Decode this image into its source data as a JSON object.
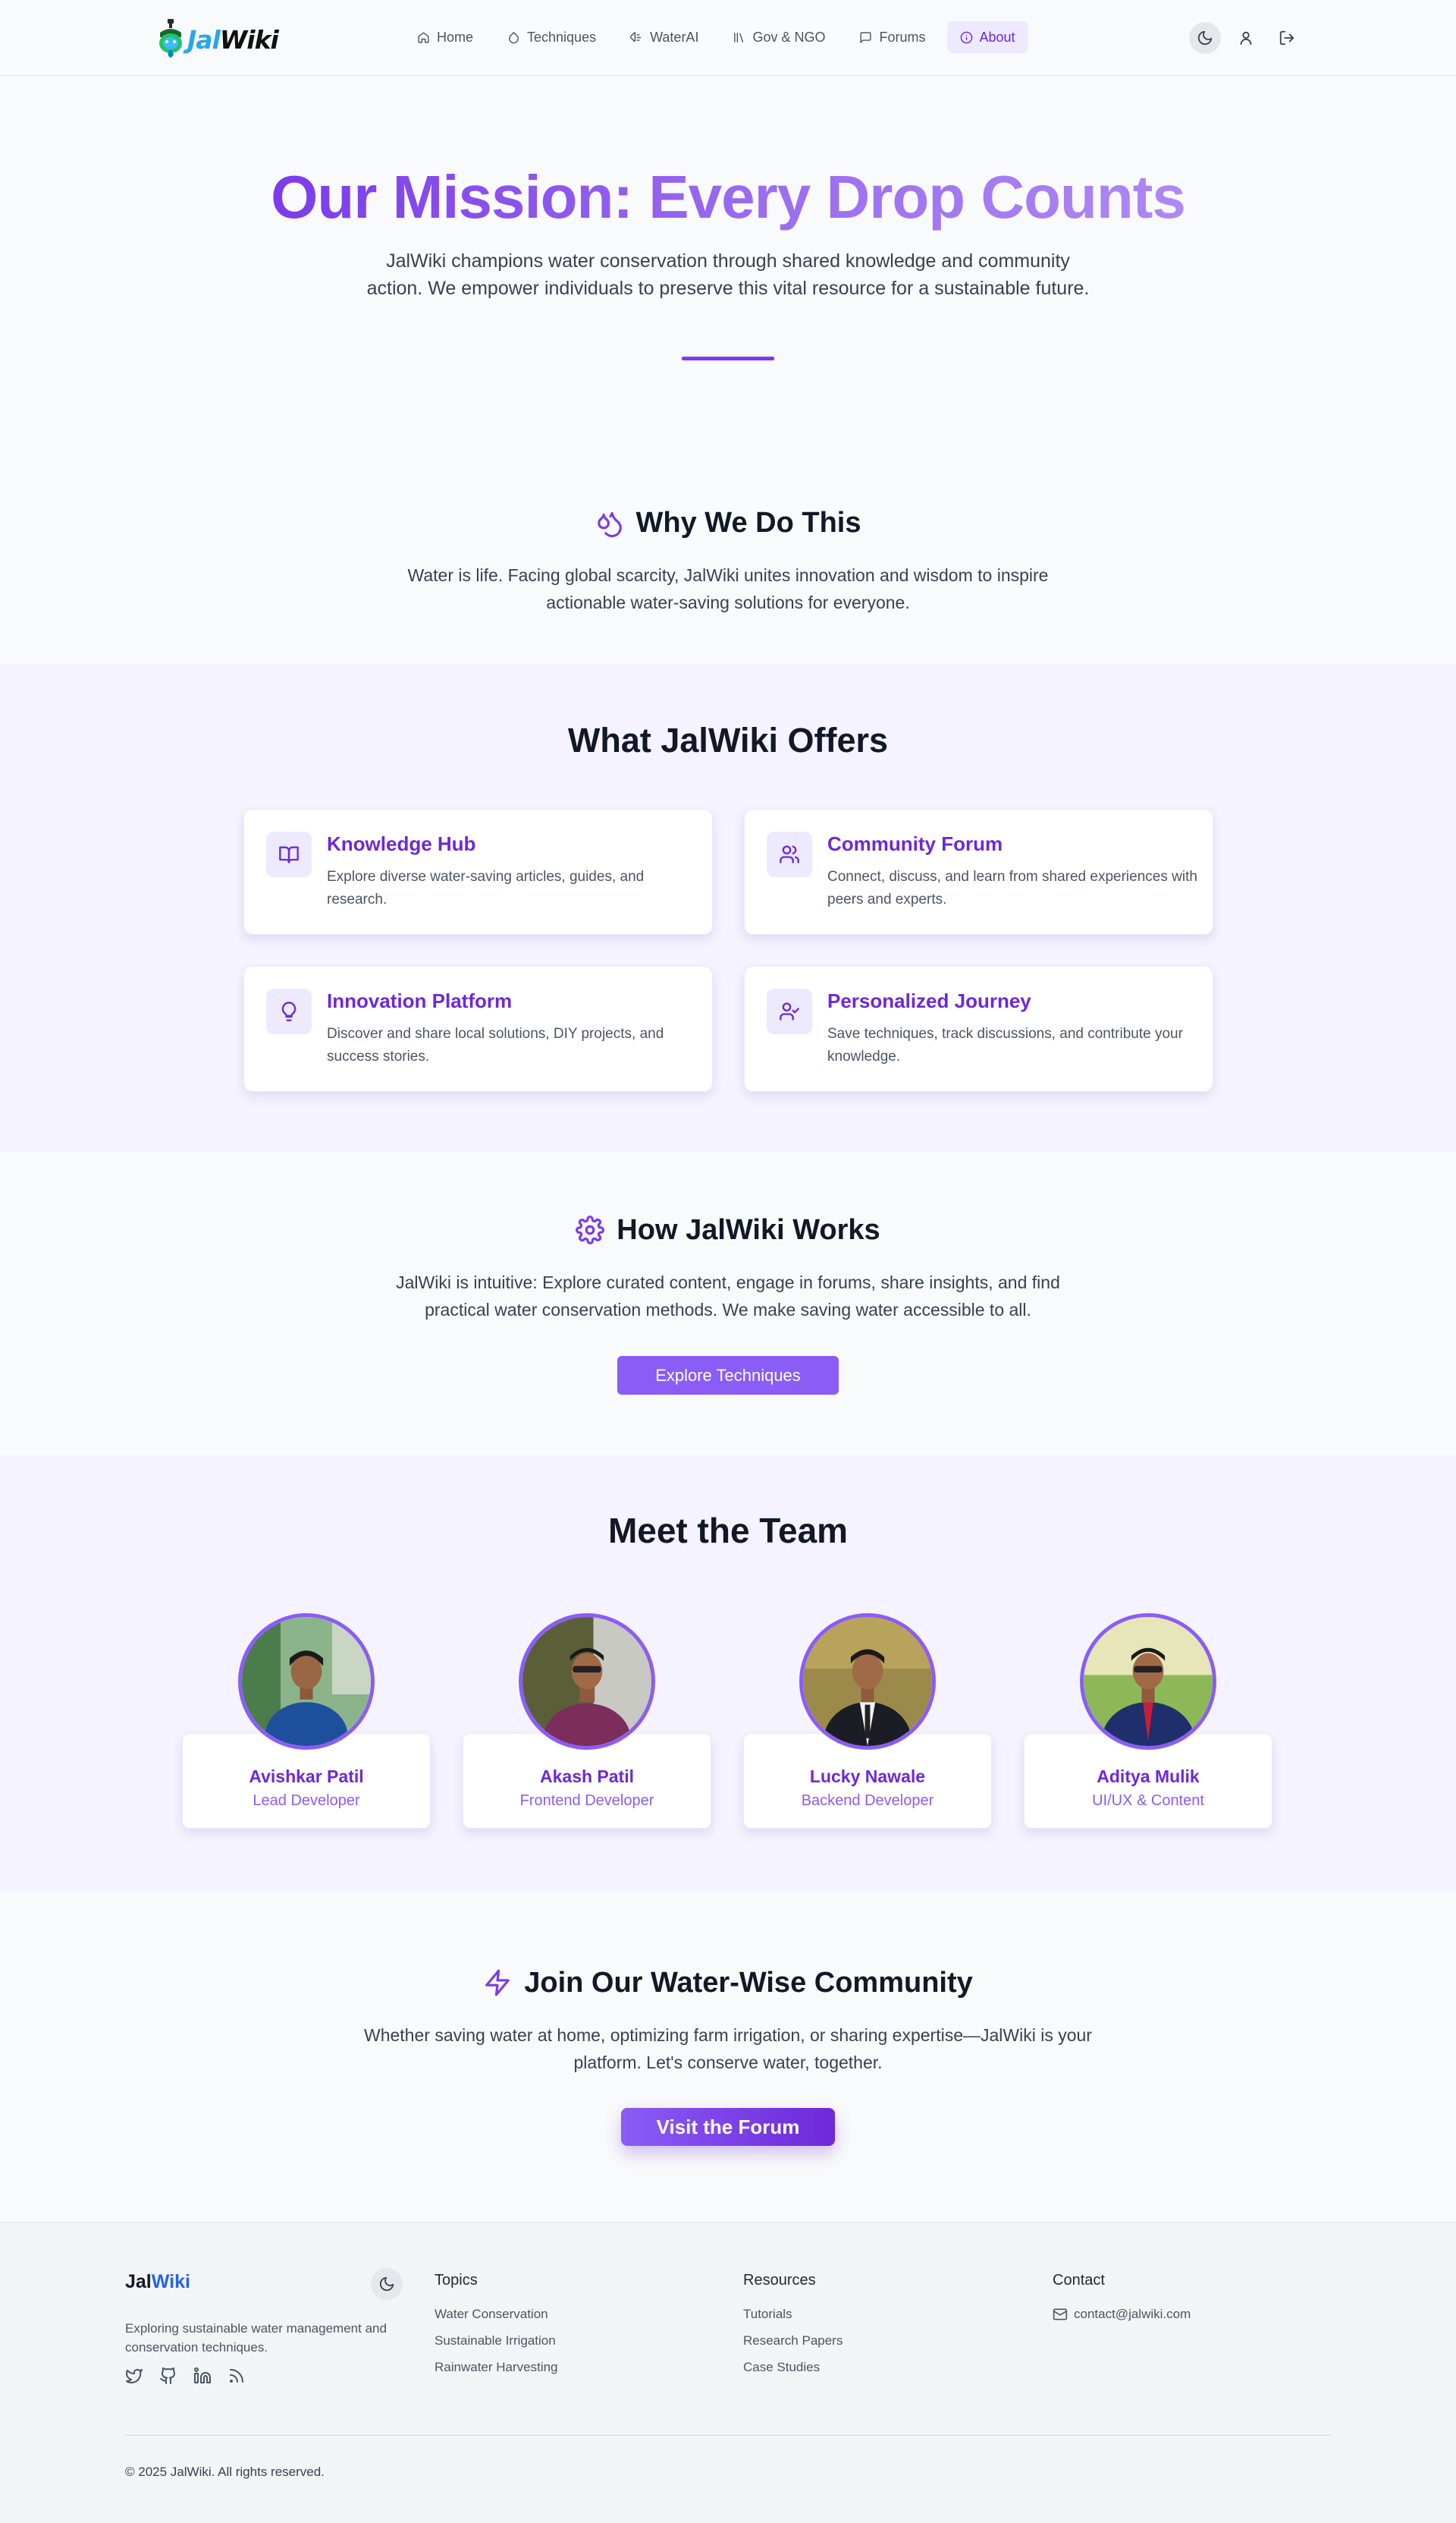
{
  "nav": {
    "logo": {
      "part1": "Jal",
      "part2": "Wiki"
    },
    "items": [
      {
        "label": "Home",
        "icon": "home-icon"
      },
      {
        "label": "Techniques",
        "icon": "droplet-icon"
      },
      {
        "label": "WaterAI",
        "icon": "ai-icon"
      },
      {
        "label": "Gov & NGO",
        "icon": "library-icon"
      },
      {
        "label": "Forums",
        "icon": "message-icon"
      },
      {
        "label": "About",
        "icon": "info-icon",
        "active": true
      }
    ],
    "right_icons": [
      "moon-icon",
      "user-icon",
      "logout-icon"
    ]
  },
  "hero": {
    "title": "Our Mission: Every Drop Counts",
    "subtitle": "JalWiki champions water conservation through shared knowledge and community action. We empower individuals to preserve this vital resource for a sustainable future."
  },
  "why": {
    "title": "Why We Do This",
    "text": "Water is life. Facing global scarcity, JalWiki unites innovation and wisdom to inspire actionable water-saving solutions for everyone."
  },
  "offers": {
    "title": "What JalWiki Offers",
    "cards": [
      {
        "title": "Knowledge Hub",
        "desc": "Explore diverse water-saving articles, guides, and research.",
        "icon": "book-icon"
      },
      {
        "title": "Community Forum",
        "desc": "Connect, discuss, and learn from shared experiences with peers and experts.",
        "icon": "users-icon"
      },
      {
        "title": "Innovation Platform",
        "desc": "Discover and share local solutions, DIY projects, and success stories.",
        "icon": "lightbulb-icon"
      },
      {
        "title": "Personalized Journey",
        "desc": "Save techniques, track discussions, and contribute your knowledge.",
        "icon": "user-check-icon"
      }
    ]
  },
  "how": {
    "title": "How JalWiki Works",
    "text": "JalWiki is intuitive: Explore curated content, engage in forums, share insights, and find practical water conservation methods. We make saving water accessible to all.",
    "button": "Explore Techniques"
  },
  "team": {
    "title": "Meet the Team",
    "members": [
      {
        "name": "Avishkar Patil",
        "role": "Lead Developer"
      },
      {
        "name": "Akash Patil",
        "role": "Frontend Developer"
      },
      {
        "name": "Lucky Nawale",
        "role": "Backend Developer"
      },
      {
        "name": "Aditya Mulik",
        "role": "UI/UX & Content"
      }
    ]
  },
  "join": {
    "title": "Join Our Water-Wise Community",
    "text": "Whether saving water at home, optimizing farm irrigation, or sharing expertise—JalWiki is your platform. Let's conserve water, together.",
    "button": "Visit the Forum"
  },
  "footer": {
    "brand": {
      "part1": "Jal",
      "part2": "Wiki"
    },
    "description": "Exploring sustainable water management and conservation techniques.",
    "social": [
      "twitter-icon",
      "github-icon",
      "linkedin-icon",
      "rss-icon"
    ],
    "columns": [
      {
        "title": "Topics",
        "links": [
          "Water Conservation",
          "Sustainable Irrigation",
          "Rainwater Harvesting"
        ]
      },
      {
        "title": "Resources",
        "links": [
          "Tutorials",
          "Research Papers",
          "Case Studies"
        ]
      },
      {
        "title": "Contact",
        "links": [
          "contact@jalwiki.com"
        ]
      }
    ],
    "copyright": "© 2025 JalWiki. All rights reserved."
  },
  "colors": {
    "accent": "#7c3aed",
    "accent_light": "#ede9fe",
    "band_bg": "#f5f3ff",
    "page_bg": "#f9fafb",
    "footer_bg": "#f3f4f6",
    "logo_blue": "#2aa7e6",
    "footer_brand_blue": "#2563eb"
  }
}
